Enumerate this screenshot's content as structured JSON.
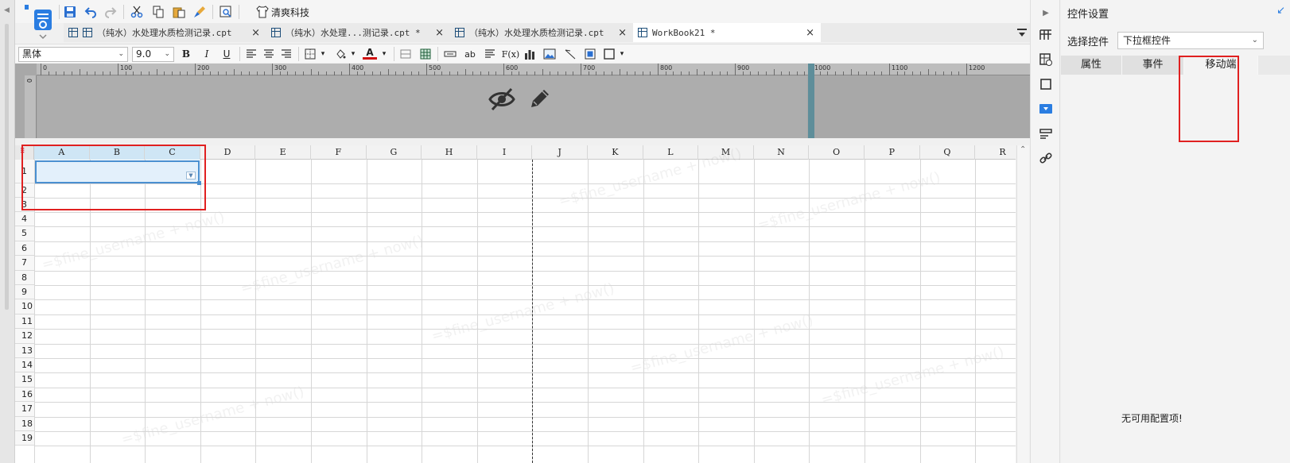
{
  "toolbar": {
    "brand_label": "清爽科技"
  },
  "tabs": [
    {
      "label": "（纯水）水处理水质检测记录.cpt",
      "close": "×"
    },
    {
      "label": "（纯水）水处理...测记录.cpt *",
      "close": "×"
    },
    {
      "label": "（纯水）水处理水质检测记录.cpt",
      "close": "×"
    },
    {
      "label": "WorkBook21 *",
      "close": "×"
    }
  ],
  "format_bar": {
    "font_name": "黑体",
    "font_size": "9.0",
    "bold": "B",
    "italic": "I",
    "underline": "U",
    "text_ab": "ab",
    "formula": "F(x)",
    "font_color_letter": "A"
  },
  "ruler": {
    "top_labels": [
      "0",
      "100",
      "200",
      "300",
      "400",
      "500",
      "600",
      "700",
      "800",
      "900",
      "1000",
      "1100",
      "1200"
    ],
    "left_label": "0"
  },
  "grid": {
    "columns": [
      "A",
      "B",
      "C",
      "D",
      "E",
      "F",
      "G",
      "H",
      "I",
      "J",
      "K",
      "L",
      "M",
      "N",
      "O",
      "P",
      "Q",
      "R"
    ],
    "rows": [
      "1",
      "2",
      "3",
      "4",
      "5",
      "6",
      "7",
      "8",
      "9",
      "10",
      "11",
      "12",
      "13",
      "14",
      "15",
      "16",
      "17",
      "18",
      "19"
    ],
    "selected_columns": [
      "A",
      "B",
      "C"
    ],
    "selected_cell": "A1",
    "watermark_text": "=$fine_username + now()"
  },
  "panel": {
    "title": "控件设置",
    "select_label": "选择控件",
    "widget_value": "下拉框控件",
    "tabs": [
      "属性",
      "事件",
      "移动端"
    ],
    "active_tab": "移动端",
    "empty_message": "无可用配置项!"
  },
  "colors": {
    "accent": "#2a7de1",
    "highlight_red": "#e02020",
    "selection_fill": "#e3f0fb",
    "selection_border": "#4a8fd0"
  }
}
